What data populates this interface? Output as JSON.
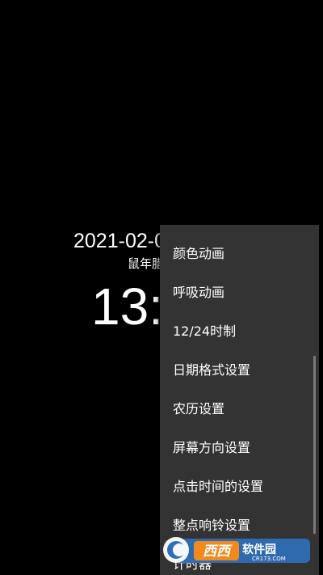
{
  "clock": {
    "date": "2021-02-0",
    "lunar": "鼠年腊",
    "time": "13:"
  },
  "menu": {
    "items": [
      "颜色动画",
      "呼吸动画",
      "12/24时制",
      "日期格式设置",
      "农历设置",
      "屏幕方向设置",
      "点击时间的设置",
      "整点响铃设置",
      "计时器"
    ]
  },
  "watermark": {
    "text": "西西软件园",
    "url": "CR173.COM"
  }
}
